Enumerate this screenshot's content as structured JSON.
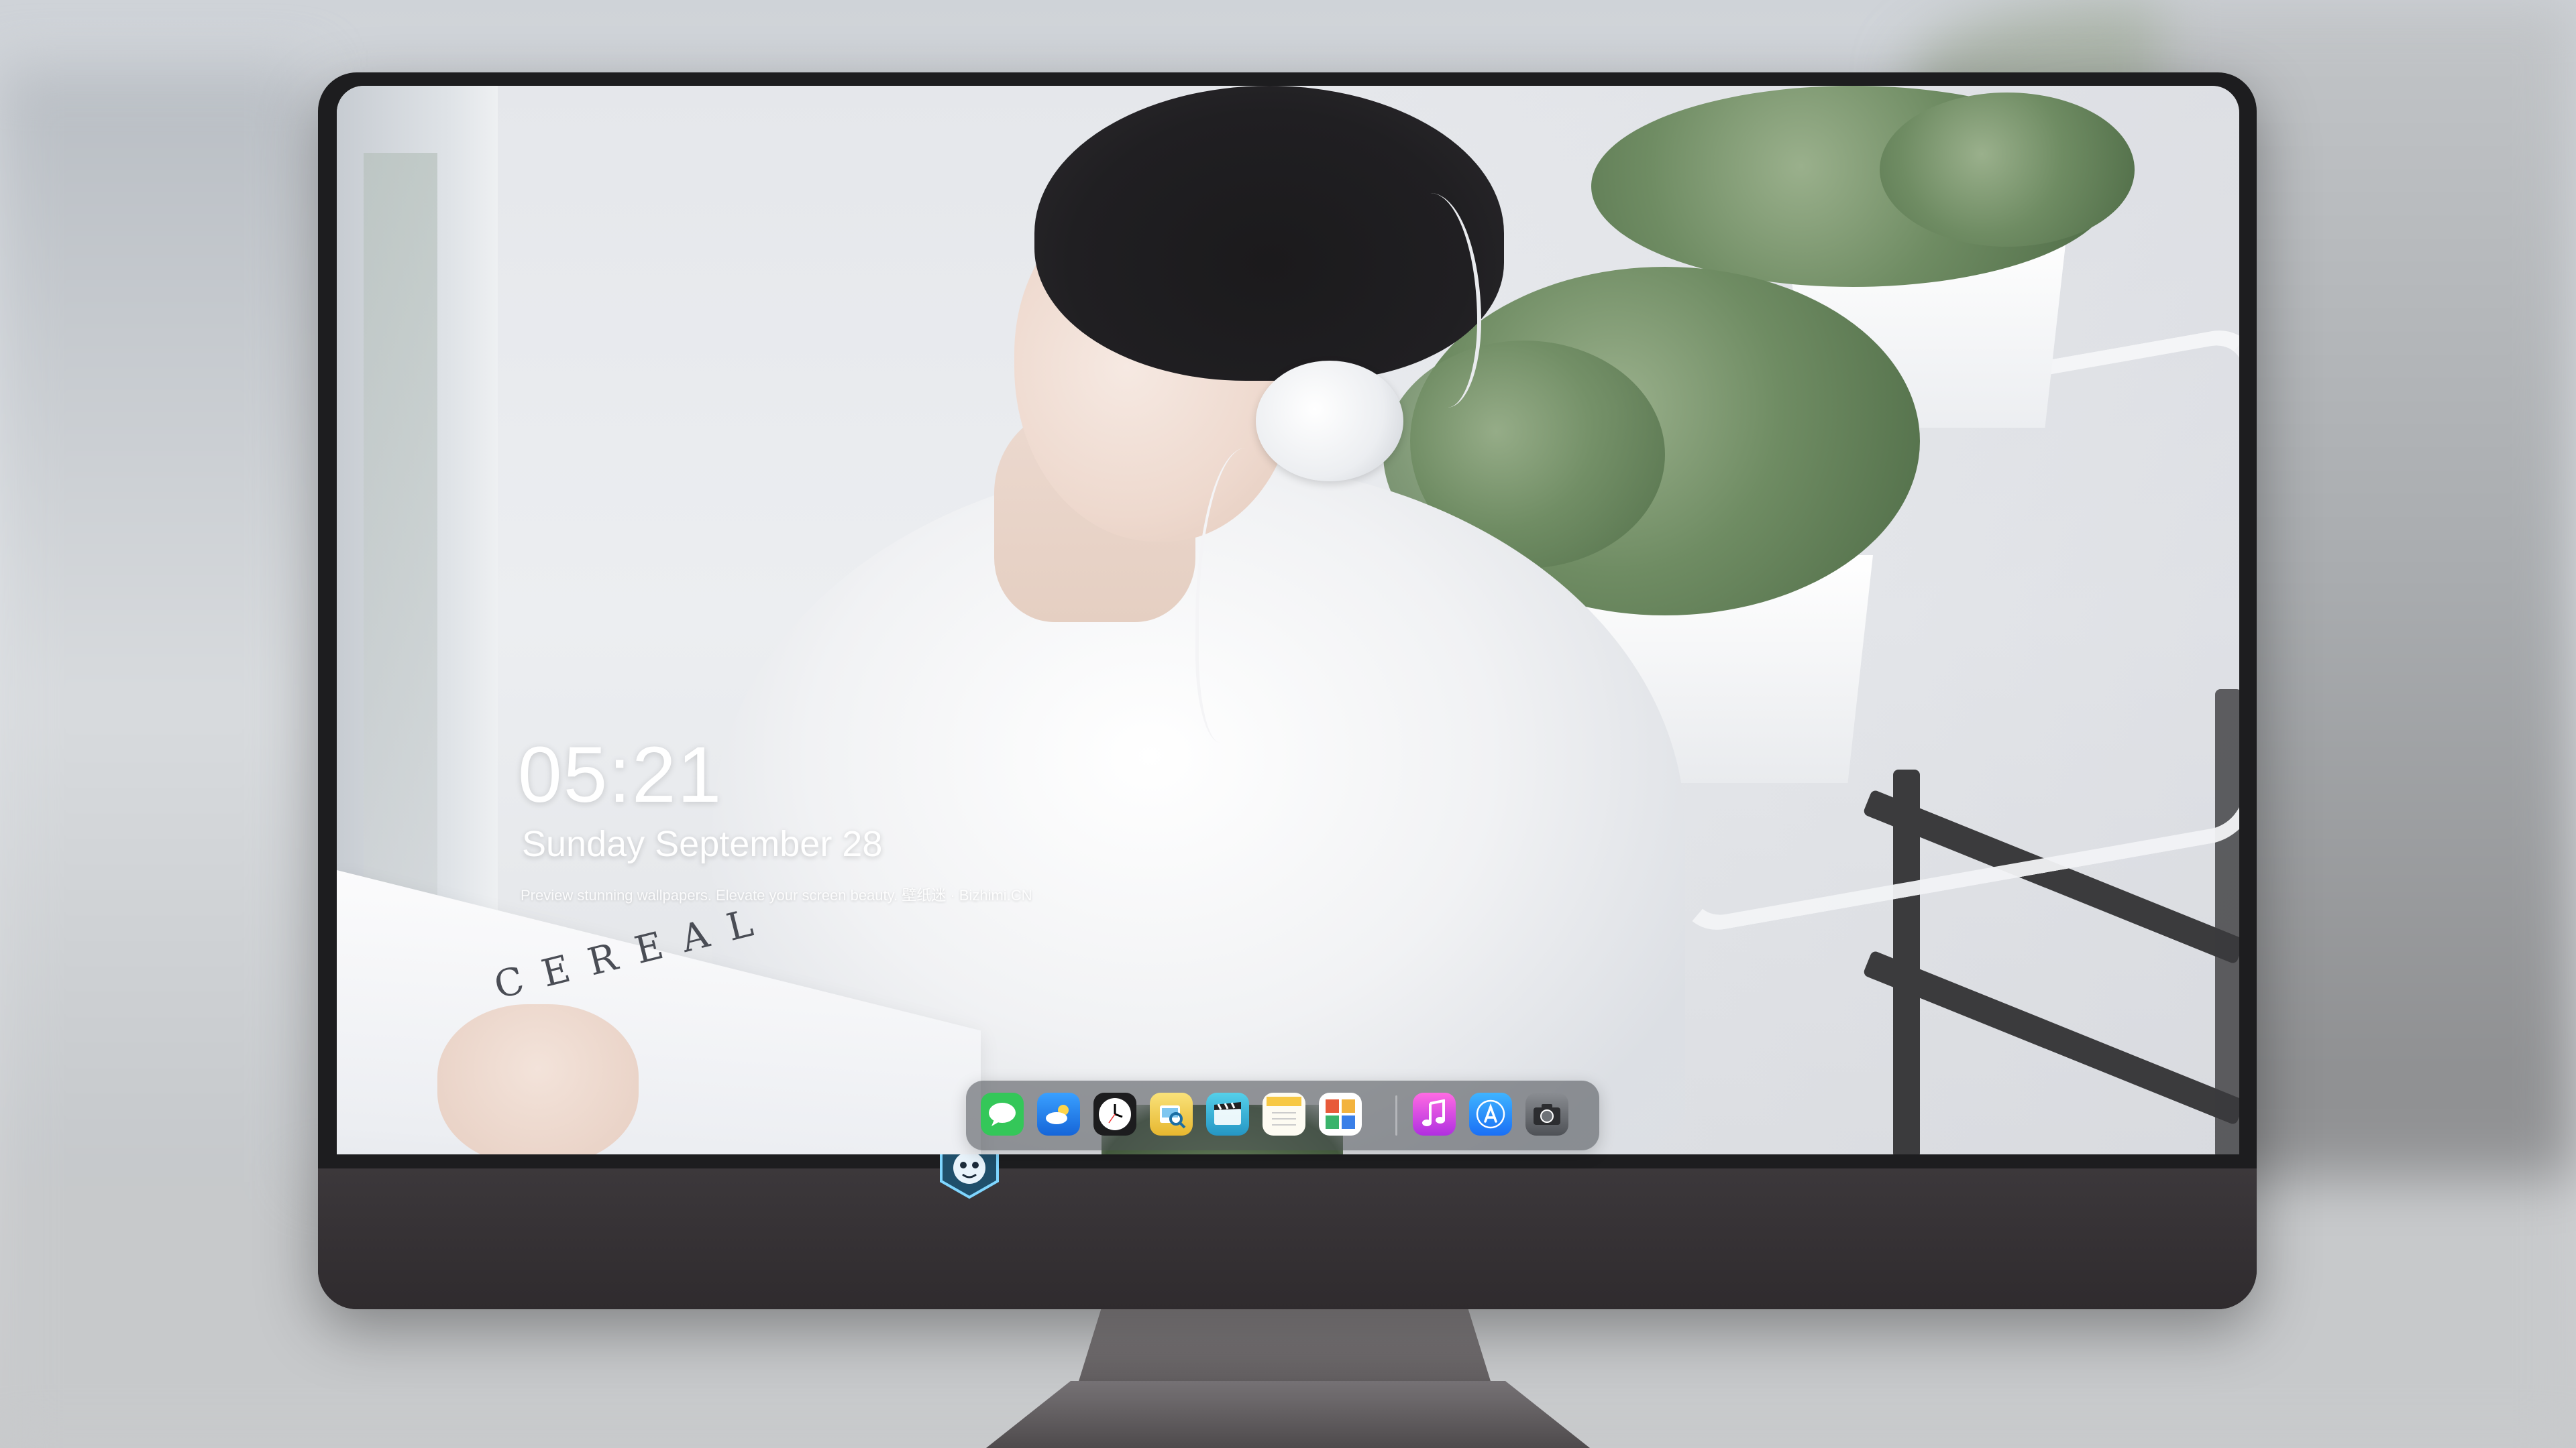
{
  "clock": {
    "time": "05:21",
    "date": "Sunday September  28",
    "tagline": "Preview stunning wallpapers. Elevate your screen beauty. 壁纸迷 · Bizhimi.CN"
  },
  "wallpaper": {
    "book_text": "CEREAL"
  },
  "dock": {
    "apps": [
      {
        "name": "messages-icon",
        "color": "#34c759"
      },
      {
        "name": "weather-icon",
        "color": "#1e90ff"
      },
      {
        "name": "clock-icon",
        "color": "#ffffff"
      },
      {
        "name": "preview-icon",
        "color": "#f2c94c"
      },
      {
        "name": "video-icon",
        "color": "#38b7d8"
      },
      {
        "name": "notes-icon",
        "color": "#f7d046"
      },
      {
        "name": "photo-booth-icon",
        "color": "#e05a3a"
      },
      {
        "name": "music-icon",
        "color": "#e34fd1"
      },
      {
        "name": "app-store-icon",
        "color": "#1c8ef9"
      },
      {
        "name": "camera-icon",
        "color": "#5a5d63"
      }
    ]
  },
  "theme": {
    "bezel": "#1d1d1f",
    "chin": "#3a3639",
    "text": "#ffffff"
  }
}
